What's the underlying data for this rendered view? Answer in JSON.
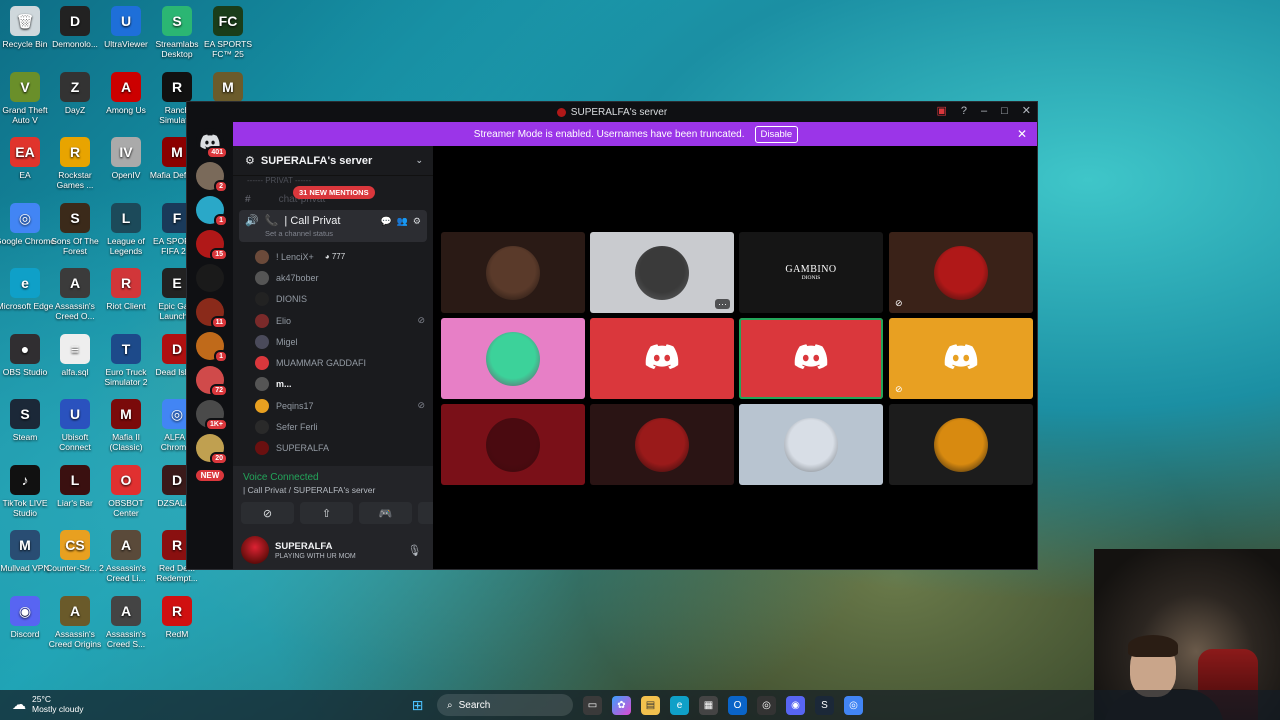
{
  "desktop": {
    "icons": [
      {
        "label": "Recycle Bin",
        "color": "#cfd8dc",
        "glyph": "🗑"
      },
      {
        "label": "Demonolo...",
        "color": "#222",
        "glyph": "D"
      },
      {
        "label": "UltraViewer",
        "color": "#1e6fd9",
        "glyph": "U"
      },
      {
        "label": "Streamlabs Desktop",
        "color": "#2bb673",
        "glyph": "S"
      },
      {
        "label": "EA SPORTS FC™ 25",
        "color": "#1a3d1a",
        "glyph": "FC"
      },
      {
        "label": "Grand Theft Auto V",
        "color": "#6a8f2a",
        "glyph": "V"
      },
      {
        "label": "DayZ",
        "color": "#333",
        "glyph": "Z"
      },
      {
        "label": "Among Us",
        "color": "#c00",
        "glyph": "A"
      },
      {
        "label": "Ranch Simulat...",
        "color": "#111",
        "glyph": "R"
      },
      {
        "label": "",
        "color": "#6b5b2b",
        "glyph": "M"
      },
      {
        "label": "EA",
        "color": "#e0342c",
        "glyph": "EA"
      },
      {
        "label": "Rockstar Games ...",
        "color": "#e8a400",
        "glyph": "R"
      },
      {
        "label": "OpenIV",
        "color": "#aaa",
        "glyph": "IV"
      },
      {
        "label": "Mafia Definit...",
        "color": "#8b0000",
        "glyph": "M"
      },
      {
        "label": "Google Chrome",
        "color": "#4285f4",
        "glyph": "◎"
      },
      {
        "label": "Sons Of The Forest",
        "color": "#3b2a1a",
        "glyph": "S"
      },
      {
        "label": "League of Legends",
        "color": "#1c4a5a",
        "glyph": "L"
      },
      {
        "label": "EA SPORTS FIFA 2...",
        "color": "#1a3a5a",
        "glyph": "F"
      },
      {
        "label": "Microsoft Edge",
        "color": "#0fa0c8",
        "glyph": "e"
      },
      {
        "label": "Assassin's Creed O...",
        "color": "#3b3b3b",
        "glyph": "A"
      },
      {
        "label": "Riot Client",
        "color": "#d13639",
        "glyph": "R"
      },
      {
        "label": "Epic Ga... Launch...",
        "color": "#222",
        "glyph": "E"
      },
      {
        "label": "OBS Studio",
        "color": "#302e31",
        "glyph": "●"
      },
      {
        "label": "alfa.sql",
        "color": "#eee",
        "glyph": "≡"
      },
      {
        "label": "Euro Truck Simulator 2",
        "color": "#1d4a8a",
        "glyph": "T"
      },
      {
        "label": "Dead Isla...",
        "color": "#b01010",
        "glyph": "D"
      },
      {
        "label": "Steam",
        "color": "#1b2838",
        "glyph": "S"
      },
      {
        "label": "Ubisoft Connect",
        "color": "#2a52be",
        "glyph": "U"
      },
      {
        "label": "Mafia II (Classic)",
        "color": "#7a0a0a",
        "glyph": "M"
      },
      {
        "label": "ALFA - Chrom...",
        "color": "#4285f4",
        "glyph": "◎"
      },
      {
        "label": "TikTok LIVE Studio",
        "color": "#111",
        "glyph": "♪"
      },
      {
        "label": "Liar's Bar",
        "color": "#3a1010",
        "glyph": "L"
      },
      {
        "label": "OBSBOT Center",
        "color": "#e03030",
        "glyph": "O"
      },
      {
        "label": "DZSALa...",
        "color": "#3a1a1a",
        "glyph": "D"
      },
      {
        "label": "Mullvad VPN",
        "color": "#294d73",
        "glyph": "M"
      },
      {
        "label": "Counter-Str... 2",
        "color": "#e8a020",
        "glyph": "CS"
      },
      {
        "label": "Assassin's Creed Li...",
        "color": "#5a4a3a",
        "glyph": "A"
      },
      {
        "label": "Red De... Redempt...",
        "color": "#8a1010",
        "glyph": "R"
      },
      {
        "label": "Discord",
        "color": "#5865f2",
        "glyph": "◉"
      },
      {
        "label": "Assassin's Creed Origins",
        "color": "#6a5a2a",
        "glyph": "A"
      },
      {
        "label": "Assassin's Creed S...",
        "color": "#444",
        "glyph": "A"
      },
      {
        "label": "RedM",
        "color": "#d01010",
        "glyph": "R"
      }
    ]
  },
  "window": {
    "title": "SUPERALFA's server",
    "banner_text": "Streamer Mode is enabled. Usernames have been truncated.",
    "banner_button": "Disable",
    "banner_color": "#9b35e8"
  },
  "rail": {
    "badges": [
      "401",
      "2",
      "1",
      "15",
      "",
      "11",
      "1",
      "72",
      "1K+",
      "20"
    ],
    "new_label": "NEW"
  },
  "sidebar": {
    "server_name": "SUPERALFA's server",
    "mentions": "31 NEW MENTIONS",
    "faded_category": "------ PRIVAT ------",
    "faded_channel": "chat-privat",
    "call_channel": "| Call Privat",
    "channel_status": "Set a channel status",
    "members": [
      {
        "name": "! LenciX+",
        "extra": "◕ 777",
        "color": "#6b4a3a",
        "muted": false
      },
      {
        "name": "ak47bober",
        "extra": "",
        "color": "#555",
        "muted": false
      },
      {
        "name": "DIONIS",
        "extra": "",
        "color": "#222",
        "muted": false
      },
      {
        "name": "Elio",
        "extra": "",
        "color": "#7a2a2a",
        "muted": true
      },
      {
        "name": "Migel",
        "extra": "",
        "color": "#4a4a5a",
        "muted": false
      },
      {
        "name": "MUAMMAR GADDAFI",
        "extra": "",
        "color": "#da373c",
        "muted": false
      },
      {
        "name": "m...",
        "extra": "",
        "color": "#555",
        "muted": false
      },
      {
        "name": "Peqins17",
        "extra": "",
        "color": "#e8a020",
        "muted": true
      },
      {
        "name": "Sefer Ferli",
        "extra": "",
        "color": "#2a2a2a",
        "muted": false
      },
      {
        "name": "SUPERALFA",
        "extra": "",
        "color": "#6a1010",
        "muted": false
      }
    ]
  },
  "voice": {
    "status": "Voice Connected",
    "location": "| Call Privat / SUPERALFA's server"
  },
  "user": {
    "name": "SUPERALFA",
    "status": "PLAYING WITH UR MOM"
  },
  "tiles": [
    {
      "bg": "#2a1a15",
      "av": "#5a3a2a",
      "kind": "avatar"
    },
    {
      "bg": "#c9cbcf",
      "av": "#3a3a3a",
      "kind": "avatar",
      "more": "···"
    },
    {
      "bg": "#151515",
      "kind": "text",
      "text": "GAMBINO",
      "sub": "DIONIS"
    },
    {
      "bg": "#3a2218",
      "av": "#b01818",
      "kind": "avatar",
      "muted": true
    },
    {
      "bg": "#e77fc6",
      "av": "#3cd29a",
      "kind": "avatar"
    },
    {
      "bg": "#da373c",
      "kind": "discord"
    },
    {
      "bg": "#da373c",
      "kind": "discord",
      "speaking": true
    },
    {
      "bg": "#e8a022",
      "kind": "discord",
      "muted": true
    },
    {
      "bg": "#7a1018",
      "av": "#4a0a10",
      "kind": "avatar"
    },
    {
      "bg": "#2a1414",
      "av": "#9a1a1a",
      "kind": "avatar"
    },
    {
      "bg": "#b8c4d0",
      "av": "#d8dee6",
      "kind": "avatar"
    },
    {
      "bg": "#1c1c1c",
      "av": "#d88a10",
      "kind": "avatar"
    }
  ],
  "taskbar": {
    "temp": "25°C",
    "weather": "Mostly cloudy",
    "search_placeholder": "Search"
  }
}
